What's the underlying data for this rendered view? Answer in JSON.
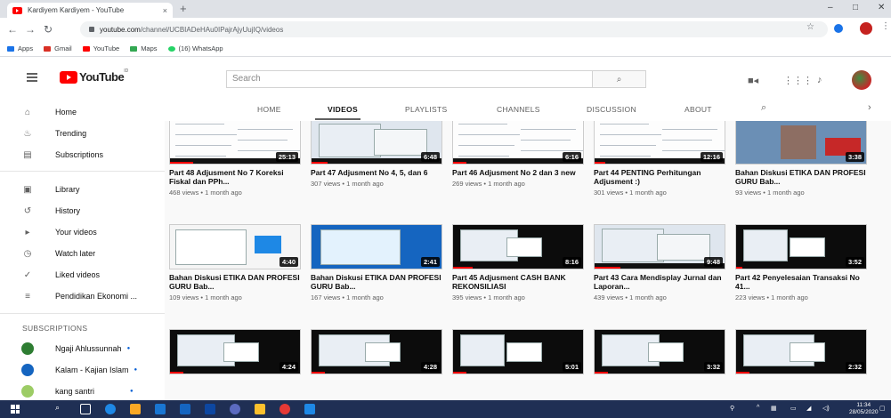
{
  "browser": {
    "tab_title": "Kardiyem Kardiyem - YouTube",
    "tab_close": "×",
    "new_tab": "+",
    "url_host": "youtube.com",
    "url_path": "/channel/UCBIADeHAu0IPajrAjyUujIQ/videos",
    "win_min": "–",
    "win_max": "□",
    "win_close": "✕",
    "bookmarks": [
      {
        "label": "Apps",
        "icon": "apps-grid-icon",
        "color": "#1a73e8"
      },
      {
        "label": "Gmail",
        "icon": "gmail-icon",
        "color": "#d93025"
      },
      {
        "label": "YouTube",
        "icon": "youtube-icon",
        "color": "#ff0000"
      },
      {
        "label": "Maps",
        "icon": "maps-icon",
        "color": "#34a853"
      },
      {
        "label": "(16) WhatsApp",
        "icon": "whatsapp-icon",
        "color": "#25d366"
      }
    ]
  },
  "masthead": {
    "logo_text": "YouTube",
    "logo_country": "ID",
    "search_placeholder": "Search",
    "search_icon": "search-icon",
    "icons": [
      "video-camera-icon",
      "apps-grid-icon",
      "bell-icon"
    ]
  },
  "sidebar": {
    "main": [
      {
        "label": "Home",
        "icon": "home-icon",
        "glyph": "⌂"
      },
      {
        "label": "Trending",
        "icon": "flame-icon",
        "glyph": "♨"
      },
      {
        "label": "Subscriptions",
        "icon": "subscriptions-icon",
        "glyph": "▤"
      }
    ],
    "library": [
      {
        "label": "Library",
        "icon": "library-icon",
        "glyph": "▣"
      },
      {
        "label": "History",
        "icon": "history-icon",
        "glyph": "↺"
      },
      {
        "label": "Your videos",
        "icon": "your-videos-icon",
        "glyph": "▸"
      },
      {
        "label": "Watch later",
        "icon": "clock-icon",
        "glyph": "◷"
      },
      {
        "label": "Liked videos",
        "icon": "thumbs-up-icon",
        "glyph": "👍"
      },
      {
        "label": "Pendidikan Ekonomi ...",
        "icon": "playlist-icon",
        "glyph": "≡"
      }
    ],
    "subscriptions_heading": "SUBSCRIPTIONS",
    "subscriptions": [
      {
        "label": "Ngaji Ahlussunnah",
        "color": "#2e7d32"
      },
      {
        "label": "Kalam - Kajian Islam",
        "color": "#1565c0"
      },
      {
        "label": "kang santri",
        "color": "#9ccc65"
      }
    ]
  },
  "channel_tabs": [
    "HOME",
    "VIDEOS",
    "PLAYLISTS",
    "CHANNELS",
    "DISCUSSION",
    "ABOUT"
  ],
  "videos": [
    {
      "title": "Part 48 Adjusment No 7 Koreksi Fiskal dan PPh...",
      "meta": "468 views • 1 month ago",
      "duration": "25:13",
      "style": "doc",
      "progress": 0.18
    },
    {
      "title": "Part 47 Adjusment No 4, 5, dan 6",
      "meta": "307 views • 1 month ago",
      "duration": "6:48",
      "style": "screen",
      "progress": 0.12
    },
    {
      "title": "Part 46 Adjusment No 2 dan 3 new",
      "meta": "269 views • 1 month ago",
      "duration": "6:16",
      "style": "doc",
      "progress": 0.1
    },
    {
      "title": "Part 44 PENTING Perhitungan Adjusment :)",
      "meta": "301 views • 1 month ago",
      "duration": "12:16",
      "style": "doc",
      "progress": 0.08
    },
    {
      "title": "Bahan Diskusi ETIKA DAN PROFESI GURU Bab...",
      "meta": "93 views • 1 month ago",
      "duration": "3:38",
      "style": "photo",
      "progress": 0.0
    },
    {
      "title": "Bahan Diskusi ETIKA DAN PROFESI GURU Bab...",
      "meta": "109 views • 1 month ago",
      "duration": "4:40",
      "style": "web",
      "progress": 0.0
    },
    {
      "title": "Bahan Diskusi ETIKA DAN PROFESI GURU Bab...",
      "meta": "167 views • 1 month ago",
      "duration": "2:41",
      "style": "blue",
      "progress": 0.0
    },
    {
      "title": "Part 45 Adjusment CASH BANK REKONSILIASI",
      "meta": "395 views • 1 month ago",
      "duration": "8:16",
      "style": "dark",
      "progress": 0.15
    },
    {
      "title": "Part 43 Cara Mendisplay Jurnal dan Laporan...",
      "meta": "439 views • 1 month ago",
      "duration": "9:48",
      "style": "screen",
      "progress": 0.2
    },
    {
      "title": "Part 42 Penyelesaian Transaksi No 41...",
      "meta": "223 views • 1 month ago",
      "duration": "3:52",
      "style": "dark",
      "progress": 0.05
    },
    {
      "title": "",
      "meta": "",
      "duration": "4:24",
      "style": "dark",
      "progress": 0.1
    },
    {
      "title": "",
      "meta": "",
      "duration": "4:28",
      "style": "dark",
      "progress": 0.1
    },
    {
      "title": "",
      "meta": "",
      "duration": "5:01",
      "style": "dark",
      "progress": 0.1
    },
    {
      "title": "",
      "meta": "",
      "duration": "3:32",
      "style": "dark",
      "progress": 0.1
    },
    {
      "title": "",
      "meta": "",
      "duration": "2:32",
      "style": "dark",
      "progress": 0.1
    }
  ],
  "taskbar": {
    "time": "11:34",
    "date": "28/05/2020",
    "apps": [
      "search-icon",
      "task-view-icon",
      "edge-icon",
      "file-explorer-icon",
      "store-icon",
      "mail-icon",
      "photos-icon",
      "chrome-icon",
      "word-icon"
    ]
  }
}
